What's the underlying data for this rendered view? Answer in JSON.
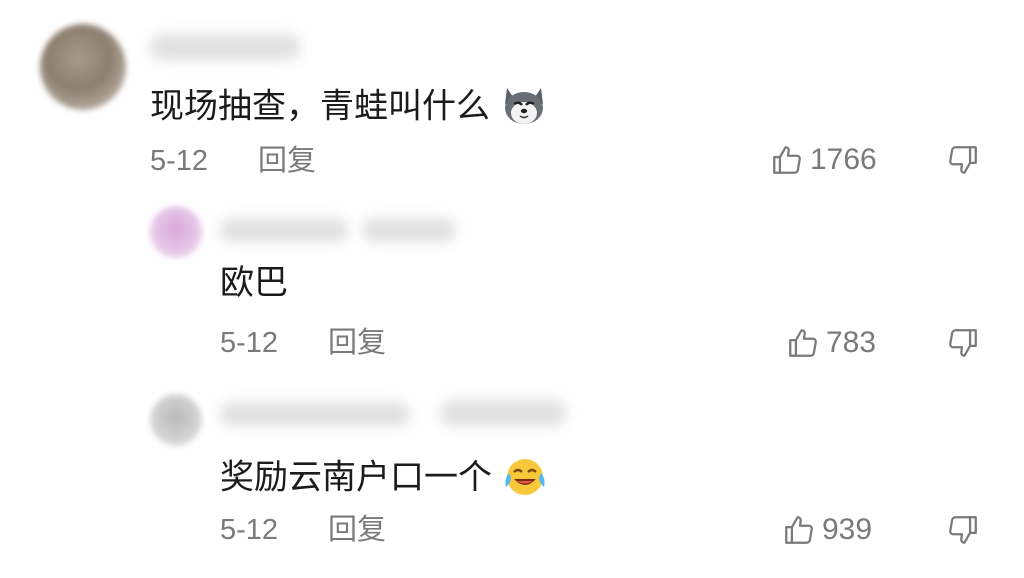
{
  "comments": [
    {
      "text": "现场抽查，青蛙叫什么",
      "emoji_icon": "husky-dog-emoji-icon",
      "date": "5-12",
      "reply_label": "回复",
      "likes": "1766",
      "replies": [
        {
          "text": "欧巴",
          "date": "5-12",
          "reply_label": "回复",
          "likes": "783"
        },
        {
          "text": "奖励云南户口一个",
          "emoji_icon": "laughing-tears-emoji-icon",
          "date": "5-12",
          "reply_label": "回复",
          "likes": "939"
        }
      ]
    }
  ],
  "colors": {
    "text": "#1b1b1b",
    "meta": "#7a7a7a",
    "background": "#ffffff"
  }
}
